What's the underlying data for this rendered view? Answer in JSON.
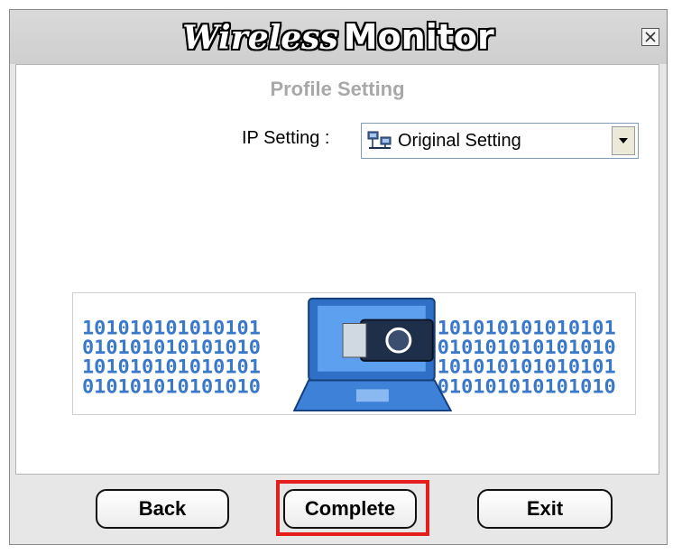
{
  "window": {
    "title_part1": "Wireless",
    "title_part2": "Monitor",
    "close_icon": "close-icon"
  },
  "profile": {
    "heading": "Profile Setting",
    "ip_label": "IP Setting :",
    "ip_selected": "Original Setting",
    "ip_icon": "network-icon"
  },
  "banner": {
    "binary_rows": [
      "101010101010101",
      "010101010101010",
      "101010101010101",
      "010101010101010"
    ]
  },
  "buttons": {
    "back": "Back",
    "complete": "Complete",
    "exit": "Exit"
  },
  "colors": {
    "highlight": "#e41d1d",
    "binary_blue": "#3a78c9",
    "subtitle_gray": "#a8a8a8"
  }
}
